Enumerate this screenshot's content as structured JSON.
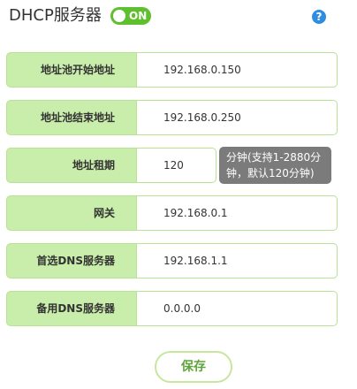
{
  "header": {
    "title": "DHCP服务器",
    "toggle_label": "ON",
    "help_symbol": "?"
  },
  "form": {
    "fields": [
      {
        "label": "地址池开始地址",
        "value": "192.168.0.150"
      },
      {
        "label": "地址池结束地址",
        "value": "192.168.0.250"
      },
      {
        "label": "地址租期",
        "value": "120"
      },
      {
        "label": "网关",
        "value": "192.168.0.1"
      },
      {
        "label": "首选DNS服务器",
        "value": "192.168.1.1"
      },
      {
        "label": "备用DNS服务器",
        "value": "0.0.0.0"
      }
    ],
    "lease_tooltip_line1": "分钟(支持1-2880分",
    "lease_tooltip_line2": "钟，默认120分钟)"
  },
  "actions": {
    "save_label": "保存"
  },
  "colors": {
    "accent": "#5fbf2e",
    "label_bg": "#c9edaa",
    "border": "#b8e395",
    "help_blue": "#2e8de0",
    "tooltip_bg": "#7b7b7b"
  },
  "icons": {
    "toggle": "toggle-switch-icon",
    "help": "help-icon"
  }
}
